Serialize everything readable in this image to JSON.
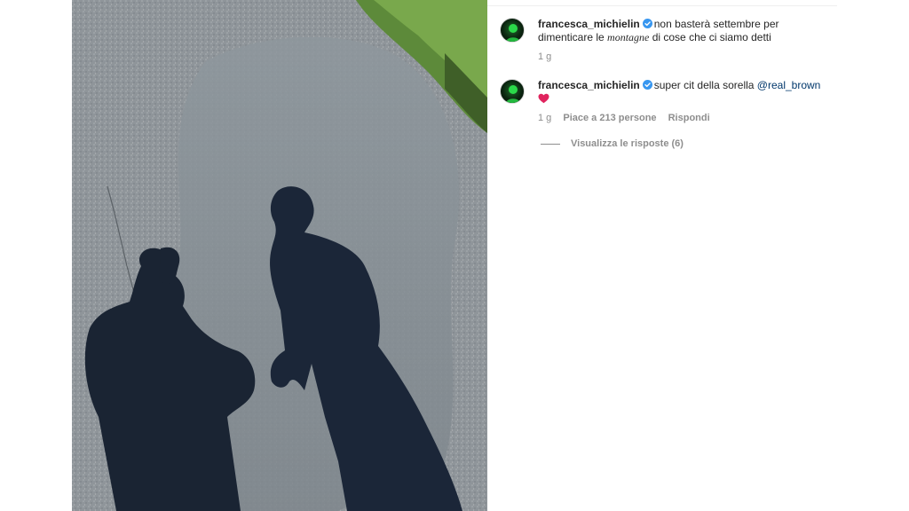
{
  "comments": [
    {
      "username": "francesca_michielin",
      "text_before": "non basterà settembre per dimenticare le ",
      "text_italic": "montagne",
      "text_after": " di cose che ci siamo detti",
      "time": "1 g"
    },
    {
      "username": "francesca_michielin",
      "text": "super cit della sorella ",
      "mention": "@real_brown",
      "time": "1 g",
      "likes": "Piace a 213 persone",
      "reply_label": "Rispondi"
    }
  ],
  "view_replies_label": "Visualizza le risposte (6)",
  "icons": {
    "verified": "verified-badge-icon",
    "heart": "red-heart-emoji",
    "next": "chevron-right-icon"
  },
  "colors": {
    "verified": "#3897f0",
    "mention": "#00376b",
    "muted": "#8e8e8e",
    "heart": "#e0245e"
  }
}
